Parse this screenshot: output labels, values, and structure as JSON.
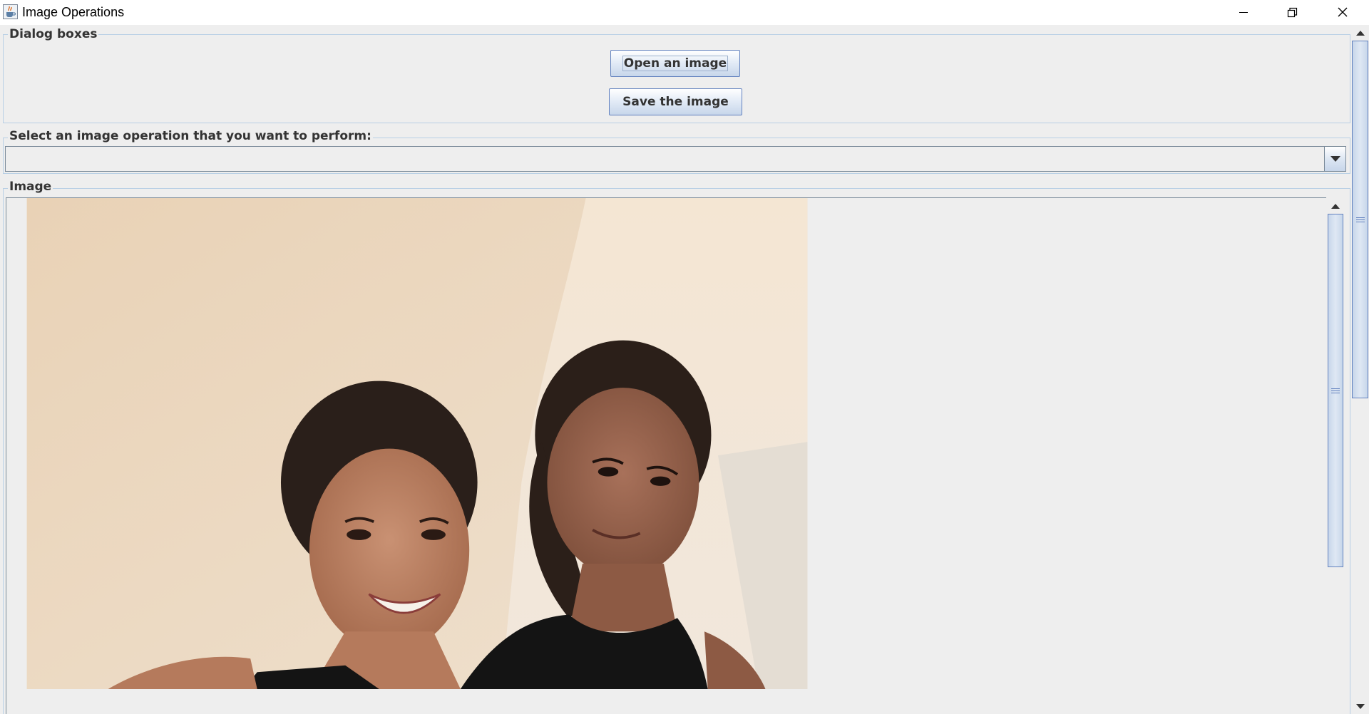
{
  "window": {
    "title": "Image Operations",
    "app_icon": "java-cup-icon",
    "controls": [
      "minimize-icon",
      "restore-icon",
      "close-icon"
    ]
  },
  "dialog_boxes": {
    "title": "Dialog boxes",
    "open_button": "Open an image",
    "save_button": "Save the image"
  },
  "operation": {
    "title": "Select an image operation that you want to perform:",
    "selected_value": ""
  },
  "image_panel": {
    "title": "Image",
    "content": "photo"
  },
  "colors": {
    "panel_bg": "#eeeeee",
    "border": "#b8cfe5",
    "button_border": "#6382bf",
    "button_grad_top": "#ffffff",
    "button_grad_bottom": "#c7d6ea"
  }
}
